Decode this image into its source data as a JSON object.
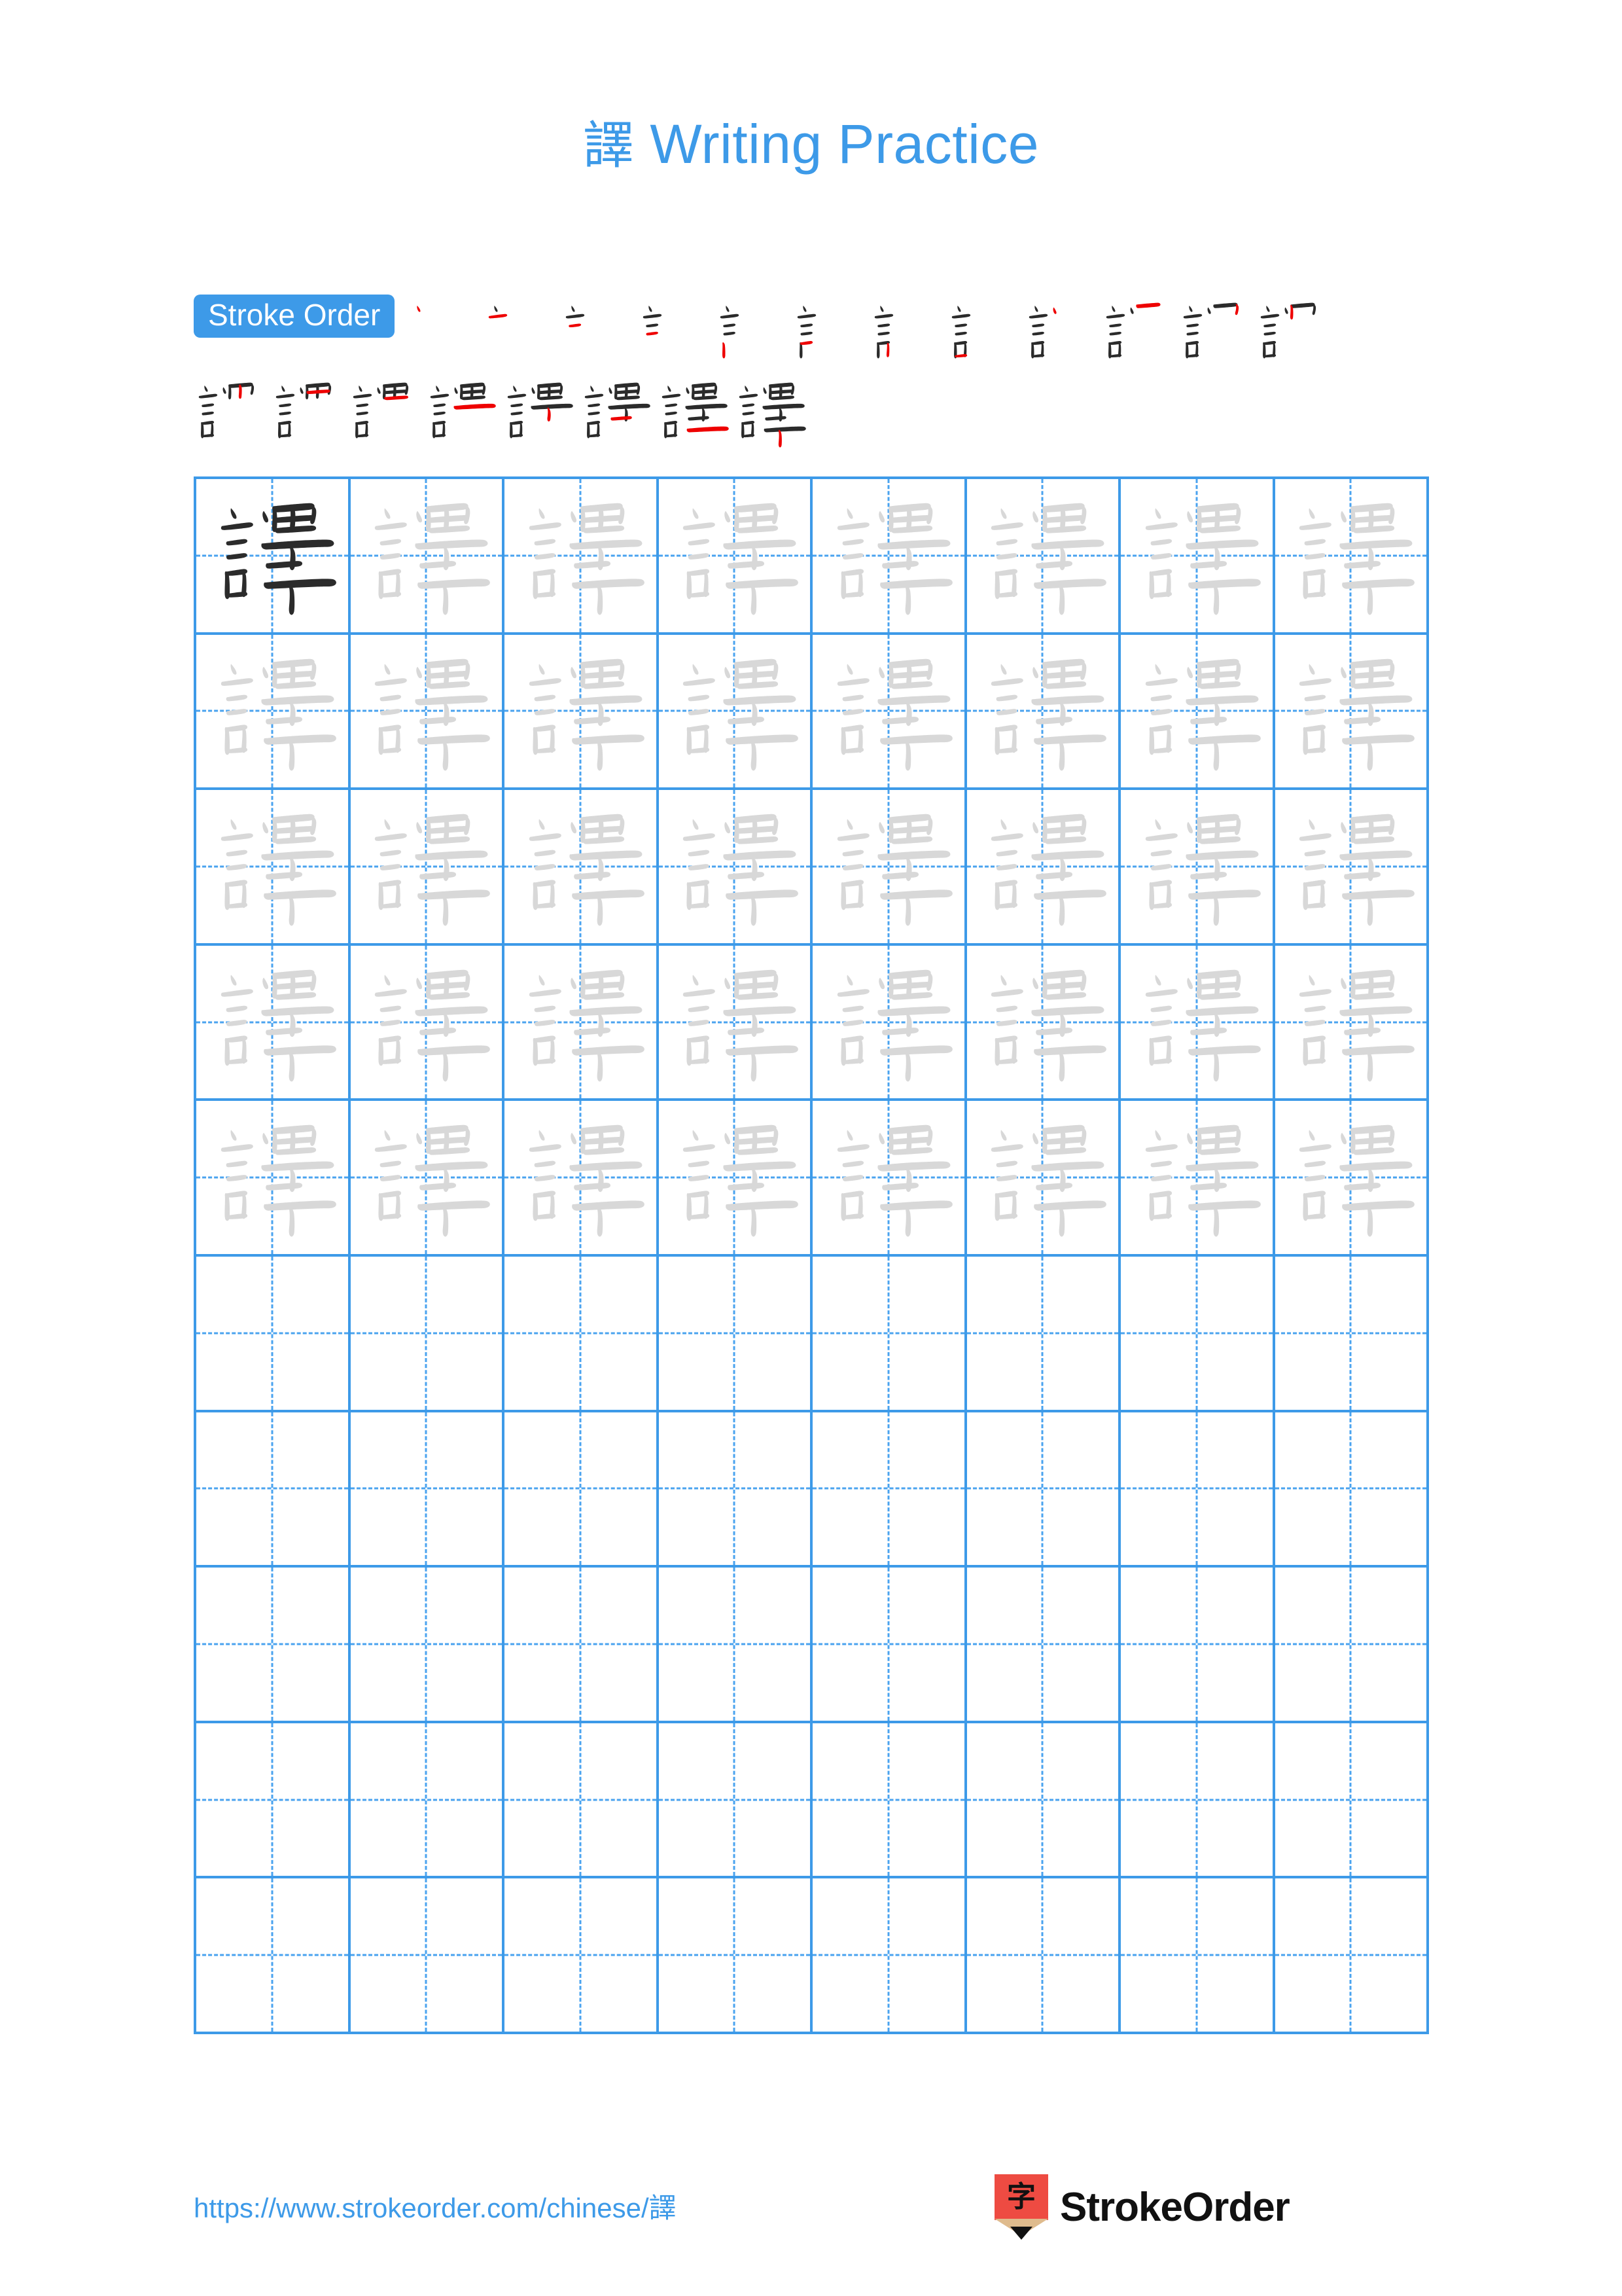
{
  "page": {
    "character": "譯",
    "title_suffix": " Writing Practice",
    "title_full": "譯 Writing Practice",
    "background_color": "#ffffff"
  },
  "colors": {
    "accent_blue": "#3d9ae8",
    "grid_line": "#3d9ae8",
    "grid_dash": "#4aa3ef",
    "trace_gray": "#d8d8d8",
    "ink_black": "#2b2b2b",
    "new_stroke_red": "#ee0000",
    "logo_red": "#ee4b42",
    "logo_wood": "#dfbb8d",
    "logo_text": "#111111"
  },
  "stroke_order": {
    "badge_label": "Stroke Order",
    "total_strokes": 20,
    "row_counts": [
      12,
      8
    ],
    "steps": [
      1,
      2,
      3,
      4,
      5,
      6,
      7,
      8,
      9,
      10,
      11,
      12,
      13,
      14,
      15,
      16,
      17,
      18,
      19,
      20
    ]
  },
  "practice_grid": {
    "rows": 10,
    "columns": 8,
    "filled_rows": 5,
    "empty_rows": 5,
    "first_cell_style": "dark",
    "trace_cell_style": "light-gray",
    "cells": [
      [
        "dark",
        "trace",
        "trace",
        "trace",
        "trace",
        "trace",
        "trace",
        "trace"
      ],
      [
        "trace",
        "trace",
        "trace",
        "trace",
        "trace",
        "trace",
        "trace",
        "trace"
      ],
      [
        "trace",
        "trace",
        "trace",
        "trace",
        "trace",
        "trace",
        "trace",
        "trace"
      ],
      [
        "trace",
        "trace",
        "trace",
        "trace",
        "trace",
        "trace",
        "trace",
        "trace"
      ],
      [
        "trace",
        "trace",
        "trace",
        "trace",
        "trace",
        "trace",
        "trace",
        "trace"
      ],
      [
        "empty",
        "empty",
        "empty",
        "empty",
        "empty",
        "empty",
        "empty",
        "empty"
      ],
      [
        "empty",
        "empty",
        "empty",
        "empty",
        "empty",
        "empty",
        "empty",
        "empty"
      ],
      [
        "empty",
        "empty",
        "empty",
        "empty",
        "empty",
        "empty",
        "empty",
        "empty"
      ],
      [
        "empty",
        "empty",
        "empty",
        "empty",
        "empty",
        "empty",
        "empty",
        "empty"
      ],
      [
        "empty",
        "empty",
        "empty",
        "empty",
        "empty",
        "empty",
        "empty",
        "empty"
      ]
    ]
  },
  "footer": {
    "url": "https://www.strokeorder.com/chinese/譯",
    "logo_char": "字",
    "logo_wordmark": "StrokeOrder"
  }
}
